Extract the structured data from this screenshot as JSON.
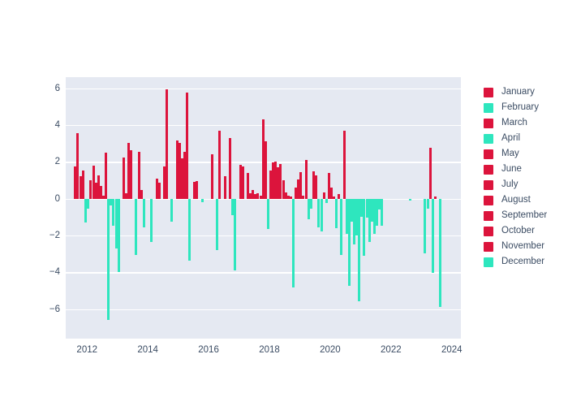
{
  "chart_data": {
    "type": "bar",
    "title": "",
    "subtitle": "",
    "xlabel": "",
    "ylabel": "",
    "xlim": [
      2011.3,
      2024.3
    ],
    "ylim": [
      -7.6,
      6.6
    ],
    "xticks": [
      2012,
      2014,
      2016,
      2018,
      2020,
      2022,
      2024
    ],
    "yticks": [
      6,
      4,
      2,
      0,
      -2,
      -4,
      -6
    ],
    "grid": true,
    "legend_position": "right",
    "colors": {
      "positive": "#DC143C",
      "negative": "#2EE6BE",
      "plot_background": "#E5E9F2",
      "paper_background": "#FFFFFF",
      "gridline": "#FFFFFF",
      "tick_text": "#3B4C63"
    },
    "legend": [
      {
        "label": "January",
        "color": "#DC143C"
      },
      {
        "label": "February",
        "color": "#2EE6BE"
      },
      {
        "label": "March",
        "color": "#DC143C"
      },
      {
        "label": "April",
        "color": "#2EE6BE"
      },
      {
        "label": "May",
        "color": "#DC143C"
      },
      {
        "label": "June",
        "color": "#DC143C"
      },
      {
        "label": "July",
        "color": "#DC143C"
      },
      {
        "label": "August",
        "color": "#DC143C"
      },
      {
        "label": "September",
        "color": "#DC143C"
      },
      {
        "label": "October",
        "color": "#DC143C"
      },
      {
        "label": "November",
        "color": "#DC143C"
      },
      {
        "label": "December",
        "color": "#2EE6BE"
      }
    ],
    "x": [
      2011.62,
      2011.7,
      2011.79,
      2011.87,
      2011.96,
      2012.04,
      2012.12,
      2012.21,
      2012.29,
      2012.37,
      2012.46,
      2012.54,
      2012.62,
      2012.71,
      2012.79,
      2012.87,
      2012.96,
      2013.04,
      2013.21,
      2013.29,
      2013.37,
      2013.46,
      2013.62,
      2013.71,
      2013.79,
      2013.87,
      2014.12,
      2014.29,
      2014.37,
      2014.54,
      2014.62,
      2014.79,
      2014.96,
      2015.04,
      2015.12,
      2015.21,
      2015.29,
      2015.37,
      2015.54,
      2015.62,
      2015.79,
      2016.12,
      2016.29,
      2016.37,
      2016.54,
      2016.71,
      2016.79,
      2016.87,
      2017.04,
      2017.12,
      2017.29,
      2017.37,
      2017.46,
      2017.54,
      2017.62,
      2017.71,
      2017.79,
      2017.87,
      2017.96,
      2018.04,
      2018.12,
      2018.21,
      2018.29,
      2018.37,
      2018.46,
      2018.54,
      2018.62,
      2018.71,
      2018.79,
      2018.87,
      2018.96,
      2019.04,
      2019.12,
      2019.21,
      2019.29,
      2019.37,
      2019.46,
      2019.54,
      2019.62,
      2019.71,
      2019.79,
      2019.87,
      2019.96,
      2020.04,
      2020.12,
      2020.21,
      2020.29,
      2020.37,
      2020.46,
      2020.54,
      2020.62,
      2020.71,
      2020.79,
      2020.87,
      2020.96,
      2021.04,
      2021.12,
      2021.21,
      2021.29,
      2021.37,
      2021.46,
      2021.54,
      2021.62,
      2021.71,
      2022.62,
      2023.12,
      2023.21,
      2023.29,
      2023.37,
      2023.46,
      2023.62
    ],
    "values": [
      1.75,
      3.55,
      1.2,
      1.55,
      -1.3,
      -0.55,
      1.0,
      1.8,
      0.85,
      1.25,
      0.7,
      0.15,
      2.5,
      -6.6,
      -0.35,
      -1.45,
      -2.7,
      -4.0,
      2.25,
      0.3,
      3.05,
      2.65,
      -3.05,
      2.55,
      0.45,
      -1.55,
      -2.35,
      1.1,
      0.85,
      1.75,
      5.95,
      -1.25,
      3.15,
      3.05,
      2.2,
      2.55,
      5.75,
      -3.35,
      0.9,
      0.95,
      -0.2,
      2.4,
      -2.8,
      3.7,
      1.2,
      3.3,
      -0.9,
      -3.9,
      1.85,
      1.75,
      1.4,
      0.3,
      0.45,
      0.25,
      0.3,
      0.15,
      4.3,
      3.1,
      -1.65,
      1.55,
      1.95,
      2.0,
      1.7,
      1.9,
      1.0,
      0.35,
      0.15,
      0.1,
      -4.8,
      0.6,
      1.05,
      1.45,
      0.15,
      2.1,
      -1.1,
      -0.55,
      1.5,
      1.25,
      -1.55,
      -1.8,
      0.35,
      -0.25,
      1.4,
      0.6,
      0.1,
      -1.6,
      0.25,
      -3.05,
      3.7,
      -1.9,
      -4.75,
      -1.25,
      -2.5,
      -2.0,
      -5.55,
      -1.0,
      -3.1,
      -1.05,
      -2.35,
      -1.25,
      -1.9,
      -1.45,
      -0.6,
      -1.45,
      -0.1,
      -2.95,
      -0.55,
      2.75,
      -4.05,
      0.1,
      -5.9
    ]
  }
}
